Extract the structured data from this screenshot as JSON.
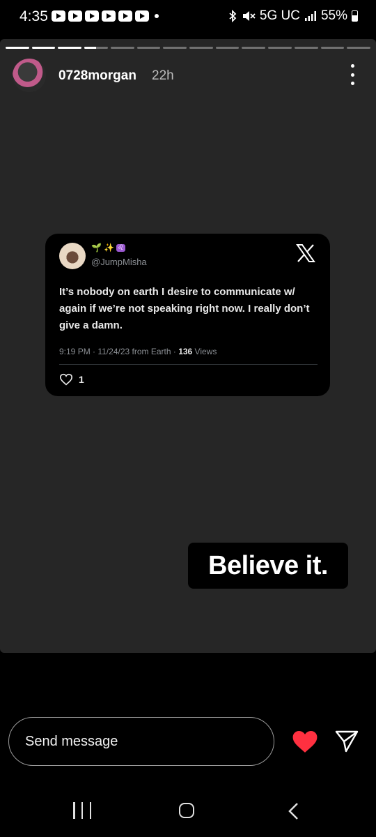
{
  "status_bar": {
    "time": "4:35",
    "network": "5G UC",
    "battery": "55%",
    "notification_icons": [
      "youtube-icon",
      "youtube-icon",
      "youtube-icon",
      "youtube-icon",
      "youtube-icon",
      "youtube-icon"
    ]
  },
  "story": {
    "segments_total": 14,
    "segments_viewed": 3,
    "current_segment_progress": 0.5,
    "username": "0728morgan",
    "time_ago": "22h"
  },
  "tweet": {
    "handle_emojis": "🌱✨♌",
    "handle": "@JumpMisha",
    "text": "It’s nobody on earth I desire to communicate w/ again if we’re not speaking right now. I really don’t give a damn.",
    "meta_prefix": "9:19 PM · 11/24/23 from Earth · ",
    "views_count": "136",
    "views_label": " Views",
    "likes": "1"
  },
  "sticker": {
    "text": "Believe it."
  },
  "reply": {
    "placeholder": "Send message",
    "heart_color": "#ff3040"
  },
  "colors": {
    "story_bg": "#262626",
    "accent_like": "#ff3040"
  }
}
